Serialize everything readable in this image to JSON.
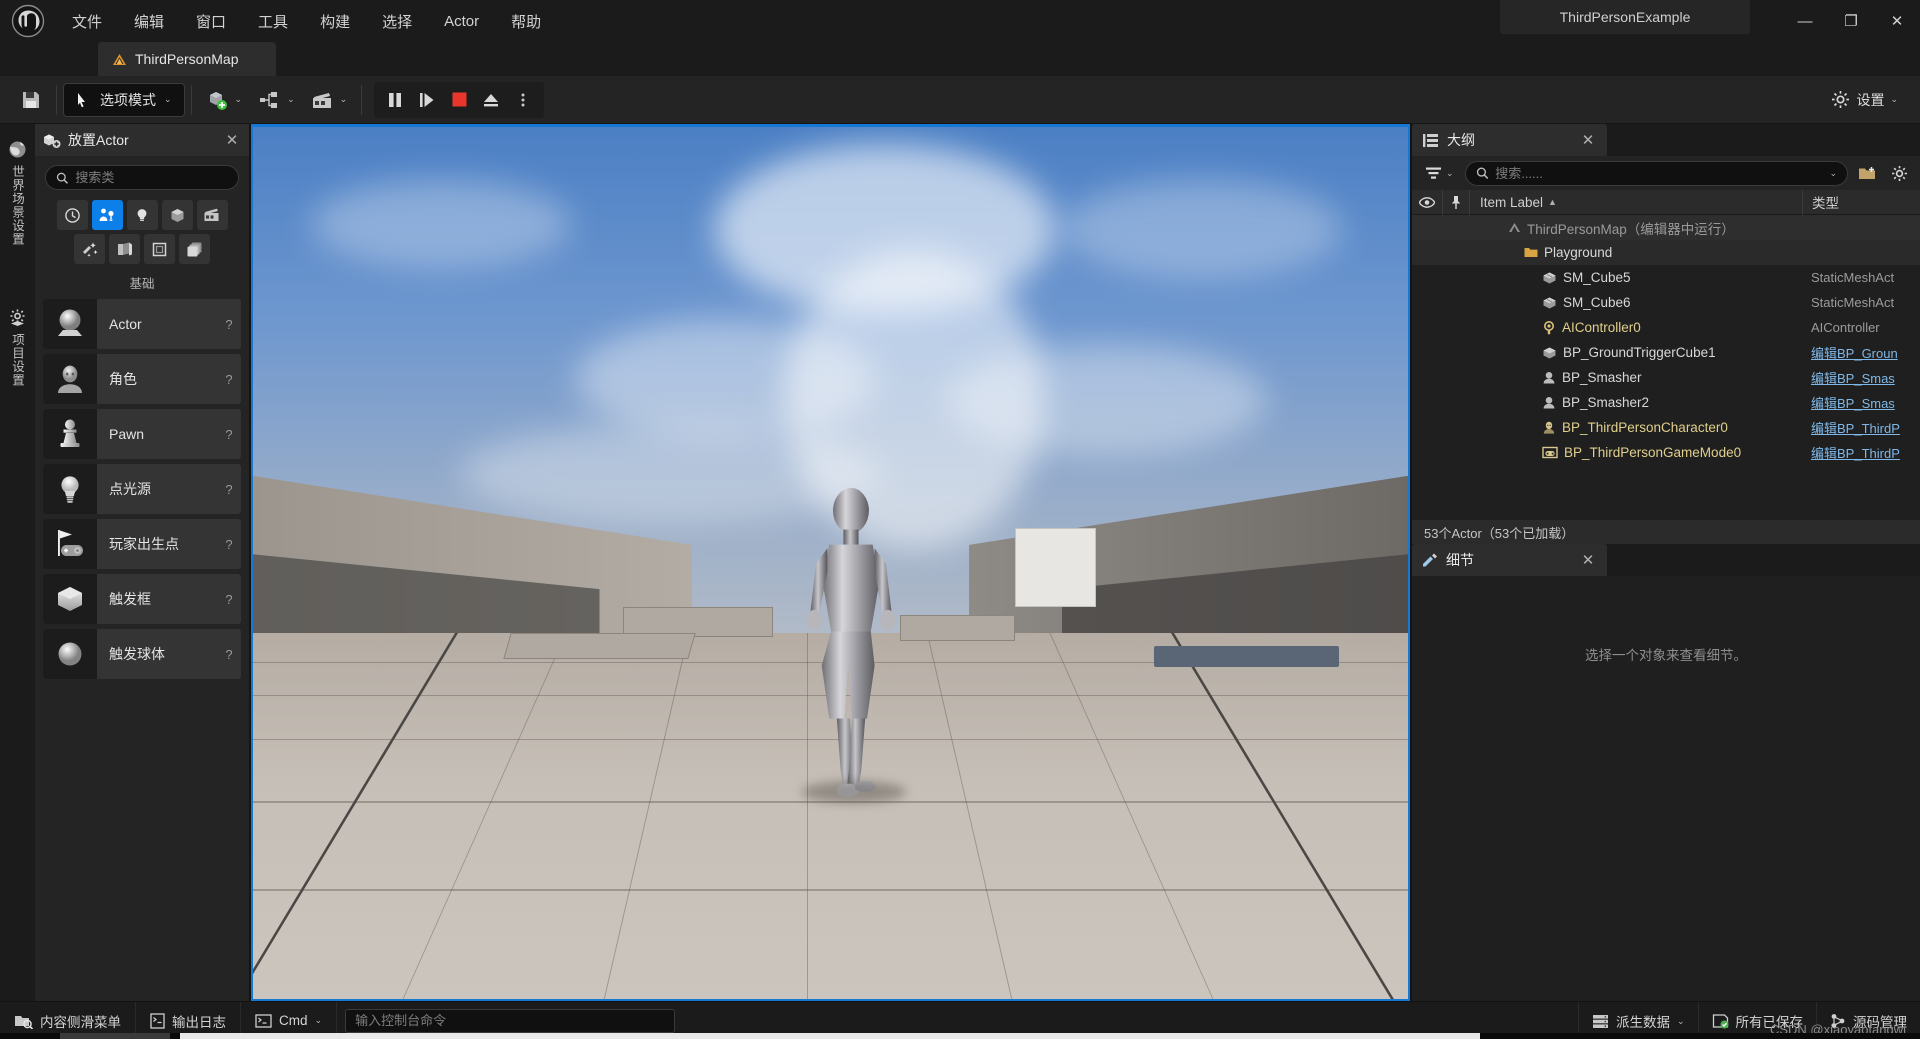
{
  "window": {
    "project_title": "ThirdPersonExample",
    "minimize": "—",
    "maximize": "❐",
    "close": "✕"
  },
  "menu": {
    "items": [
      {
        "label": "文件"
      },
      {
        "label": "编辑"
      },
      {
        "label": "窗口"
      },
      {
        "label": "工具"
      },
      {
        "label": "构建"
      },
      {
        "label": "选择"
      },
      {
        "label": "Actor"
      },
      {
        "label": "帮助"
      }
    ]
  },
  "tabs": {
    "map_tab": "ThirdPersonMap"
  },
  "toolbar": {
    "mode_label": "选项模式",
    "settings_label": "设置",
    "caret": "⌄"
  },
  "vertical_tabs": [
    {
      "label": "世界场景设置",
      "icon": "globe-icon"
    },
    {
      "label": "项目设置",
      "icon": "gear-icon"
    }
  ],
  "place_actor": {
    "title": "放置Actor",
    "close": "✕",
    "search_placeholder": "搜索类",
    "search_value": "",
    "category_label": "基础",
    "categories": [
      {
        "name": "recent-icon",
        "active": false
      },
      {
        "name": "basic-icon",
        "active": true
      },
      {
        "name": "lights-icon",
        "active": false
      },
      {
        "name": "shapes-icon",
        "active": false
      },
      {
        "name": "cinematic-icon",
        "active": false
      },
      {
        "name": "visual-effects-icon",
        "active": false
      },
      {
        "name": "geometry-icon",
        "active": false
      },
      {
        "name": "volumes-icon",
        "active": false
      },
      {
        "name": "all-classes-icon",
        "active": false
      }
    ],
    "items": [
      {
        "label": "Actor",
        "icon": "actor-sphere-icon",
        "help": "?"
      },
      {
        "label": "角色",
        "icon": "character-icon",
        "help": "?"
      },
      {
        "label": "Pawn",
        "icon": "pawn-icon",
        "help": "?"
      },
      {
        "label": "点光源",
        "icon": "point-light-icon",
        "help": "?"
      },
      {
        "label": "玩家出生点",
        "icon": "player-start-icon",
        "help": "?"
      },
      {
        "label": "触发框",
        "icon": "trigger-box-icon",
        "help": "?"
      },
      {
        "label": "触发球体",
        "icon": "trigger-sphere-icon",
        "help": "?"
      }
    ]
  },
  "outliner": {
    "title": "大纲",
    "close": "✕",
    "search_placeholder": "搜索......",
    "search_value": "",
    "columns": {
      "eye": "eye-icon",
      "pin": "pin-icon",
      "item_label": "Item Label",
      "sort_caret": "▲",
      "type": "类型"
    },
    "rows": [
      {
        "label": "ThirdPersonMap（编辑器中运行）",
        "type": "",
        "icon": "level-icon",
        "indent": 0,
        "level": "lvl0",
        "type_link": false
      },
      {
        "label": "Playground",
        "type": "",
        "icon": "folder-icon",
        "indent": 1,
        "level": "lvl1",
        "type_link": false
      },
      {
        "label": "SM_Cube5",
        "type": "StaticMeshAct",
        "icon": "mesh-icon",
        "indent": 2,
        "level": "",
        "type_link": false
      },
      {
        "label": "SM_Cube6",
        "type": "StaticMeshAct",
        "icon": "mesh-icon",
        "indent": 2,
        "level": "",
        "type_link": false
      },
      {
        "label": "AIController0",
        "type": "AIController",
        "icon": "ai-icon",
        "indent": 2,
        "level": "",
        "type_link": false
      },
      {
        "label": "BP_GroundTriggerCube1",
        "type": "编辑BP_Groun",
        "icon": "mesh-icon",
        "indent": 2,
        "level": "",
        "type_link": true
      },
      {
        "label": "BP_Smasher",
        "type": "编辑BP_Smas",
        "icon": "bp-actor-icon",
        "indent": 2,
        "level": "",
        "type_link": true
      },
      {
        "label": "BP_Smasher2",
        "type": "编辑BP_Smas",
        "icon": "bp-actor-icon",
        "indent": 2,
        "level": "",
        "type_link": true
      },
      {
        "label": "BP_ThirdPersonCharacter0",
        "type": "编辑BP_ThirdP",
        "icon": "character-bp-icon",
        "indent": 2,
        "level": "",
        "type_link": true
      },
      {
        "label": "BP_ThirdPersonGameMode0",
        "type": "编辑BP_ThirdP",
        "icon": "gamemode-icon",
        "indent": 2,
        "level": "",
        "type_link": true
      }
    ],
    "count_text": "53个Actor（53个已加载）"
  },
  "details": {
    "title": "细节",
    "close": "✕",
    "empty_text": "选择一个对象来查看细节。"
  },
  "statusbar": {
    "left_buttons": [
      {
        "label": "内容侧滑菜单",
        "icon": "content-drawer-icon"
      },
      {
        "label": "输出日志",
        "icon": "output-log-icon"
      },
      {
        "label": "Cmd",
        "icon": "cmd-icon",
        "caret": "⌄"
      }
    ],
    "console_placeholder": "输入控制台命令",
    "console_value": "",
    "right_buttons": [
      {
        "label": "派生数据",
        "icon": "derived-data-icon",
        "caret": "⌄"
      },
      {
        "label": "所有已保存",
        "icon": "saved-icon"
      },
      {
        "label": "源码管理",
        "icon": "source-control-icon"
      }
    ],
    "watermark": "CSDN @xiaoyaofangwj"
  },
  "colors": {
    "accent_blue": "#0c7fe8",
    "viewport_border": "#1478d4",
    "folder_gold": "#d9a441",
    "link_blue": "#7fb8e8",
    "record_red": "#e8362c",
    "panel_bg": "#242424",
    "dark_bg": "#1b1b1b"
  }
}
